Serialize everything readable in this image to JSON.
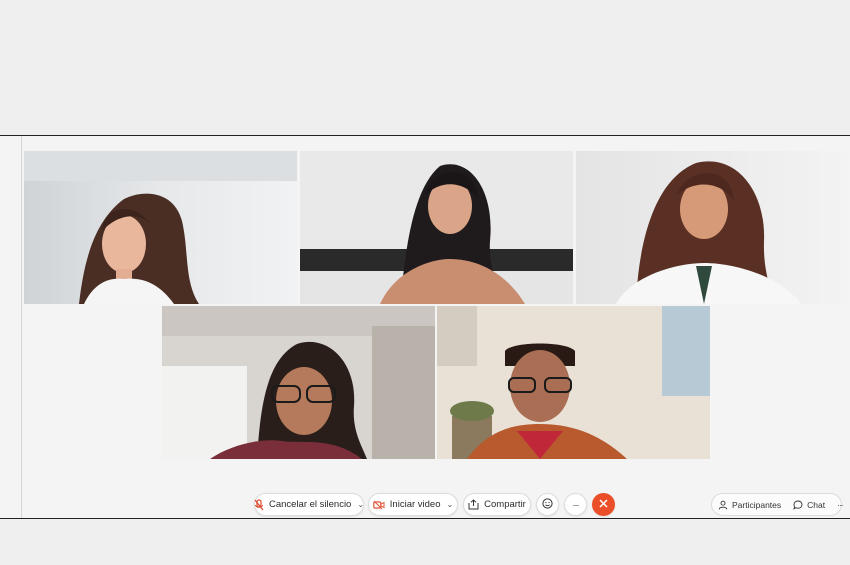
{
  "toolbar": {
    "unmute_label": "Cancelar el silencio",
    "video_label": "Iniciar video",
    "share_label": "Compartir",
    "more_glyph": "···"
  },
  "side_panel": {
    "participants_label": "Participantes",
    "chat_label": "Chat",
    "more_glyph": "···"
  },
  "colors": {
    "end_call": "#ea4f2a",
    "video_icon": "#e2563b",
    "mic_icon": "#d9472b"
  },
  "participants_tiles": [
    {
      "name": ""
    },
    {
      "name": ""
    },
    {
      "name": ""
    },
    {
      "name": ""
    },
    {
      "name": ""
    }
  ]
}
